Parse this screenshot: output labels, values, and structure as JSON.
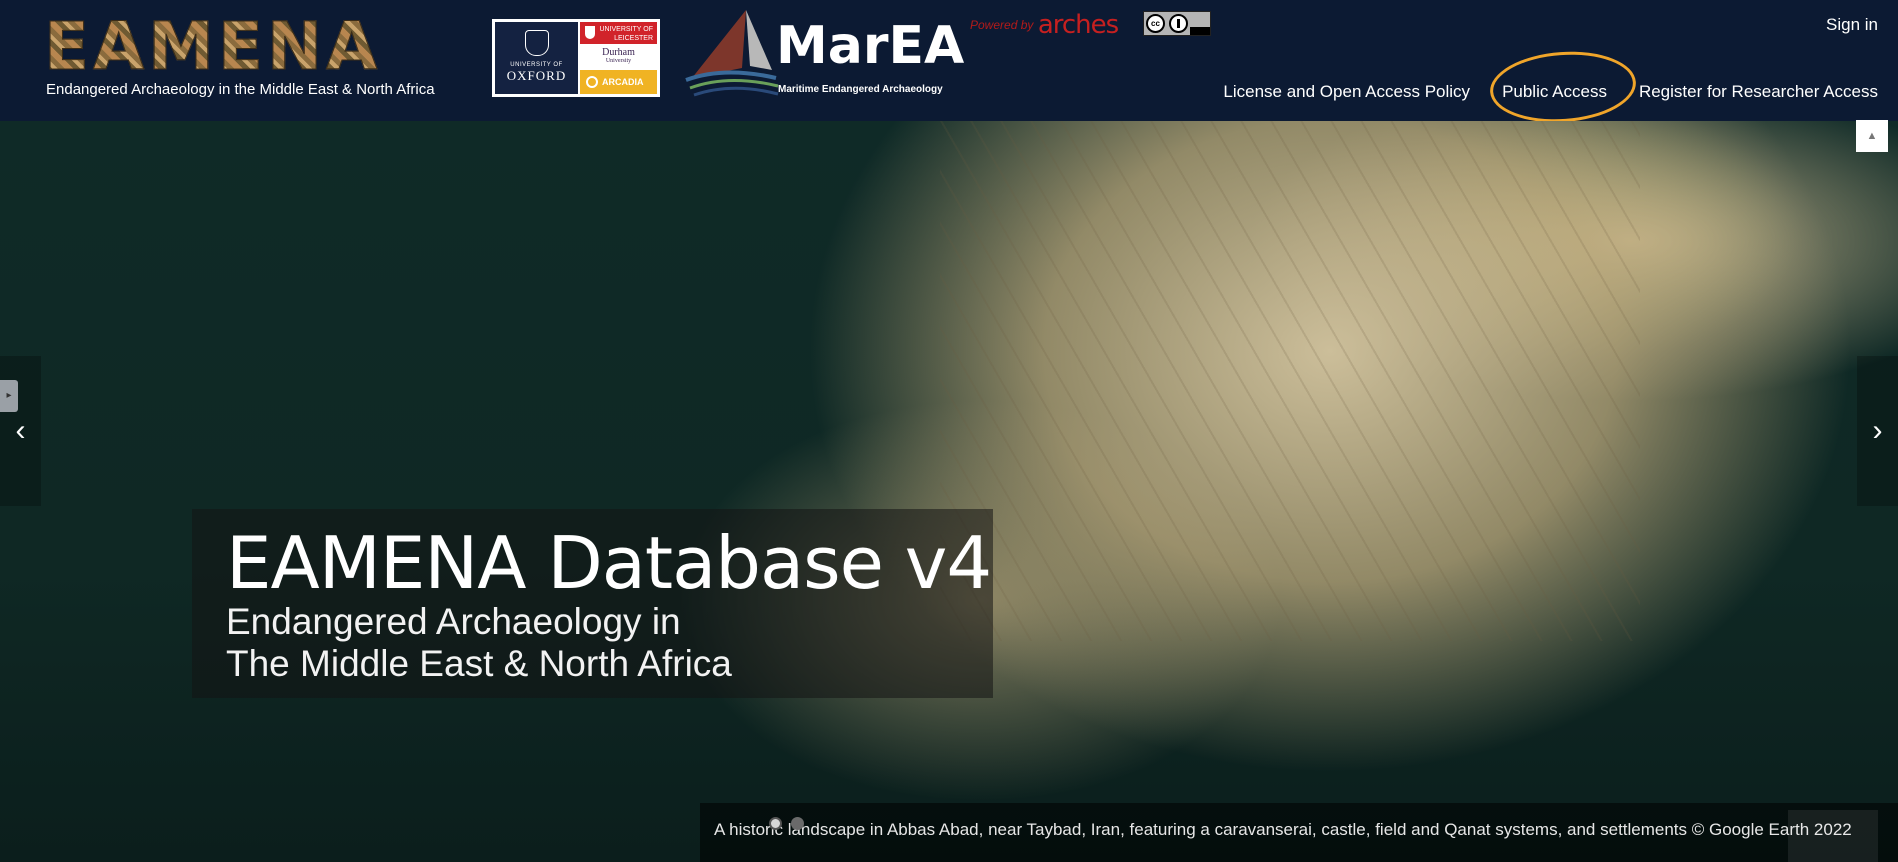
{
  "header": {
    "eamena_word": "EAMENA",
    "eamena_subtitle": "Endangered Archaeology in the Middle East & North Africa",
    "partners": {
      "oxford_small": "UNIVERSITY OF",
      "oxford_big": "OXFORD",
      "leicester": "UNIVERSITY OF LEICESTER",
      "durham": "Durham",
      "durham_small": "University",
      "arcadia": "ARCADIA"
    },
    "marea_word": "MarEA",
    "marea_subtitle": "Maritime Endangered Archaeology",
    "powered_by": "Powered by",
    "arches": "arches",
    "cc_label": "cc",
    "sign_in": "Sign in",
    "nav": {
      "license": "License and Open Access Policy",
      "public": "Public Access",
      "register": "Register for Researcher Access"
    },
    "annotation_color": "#f0a52a"
  },
  "hero": {
    "title": "EAMENA Database v4",
    "subtitle_line1": "Endangered Archaeology in",
    "subtitle_line2": "The Middle East & North Africa",
    "caption": "A historic landscape in Abbas Abad, near Taybad, Iran, featuring a caravanserai, castle, field and Qanat systems, and settlements © Google Earth 2022",
    "prev_icon": "‹",
    "next_icon": "›",
    "slides_total": 2,
    "slide_active": 1
  },
  "colors": {
    "header_bg": "#0c1a33",
    "arches_red": "#c62020"
  }
}
